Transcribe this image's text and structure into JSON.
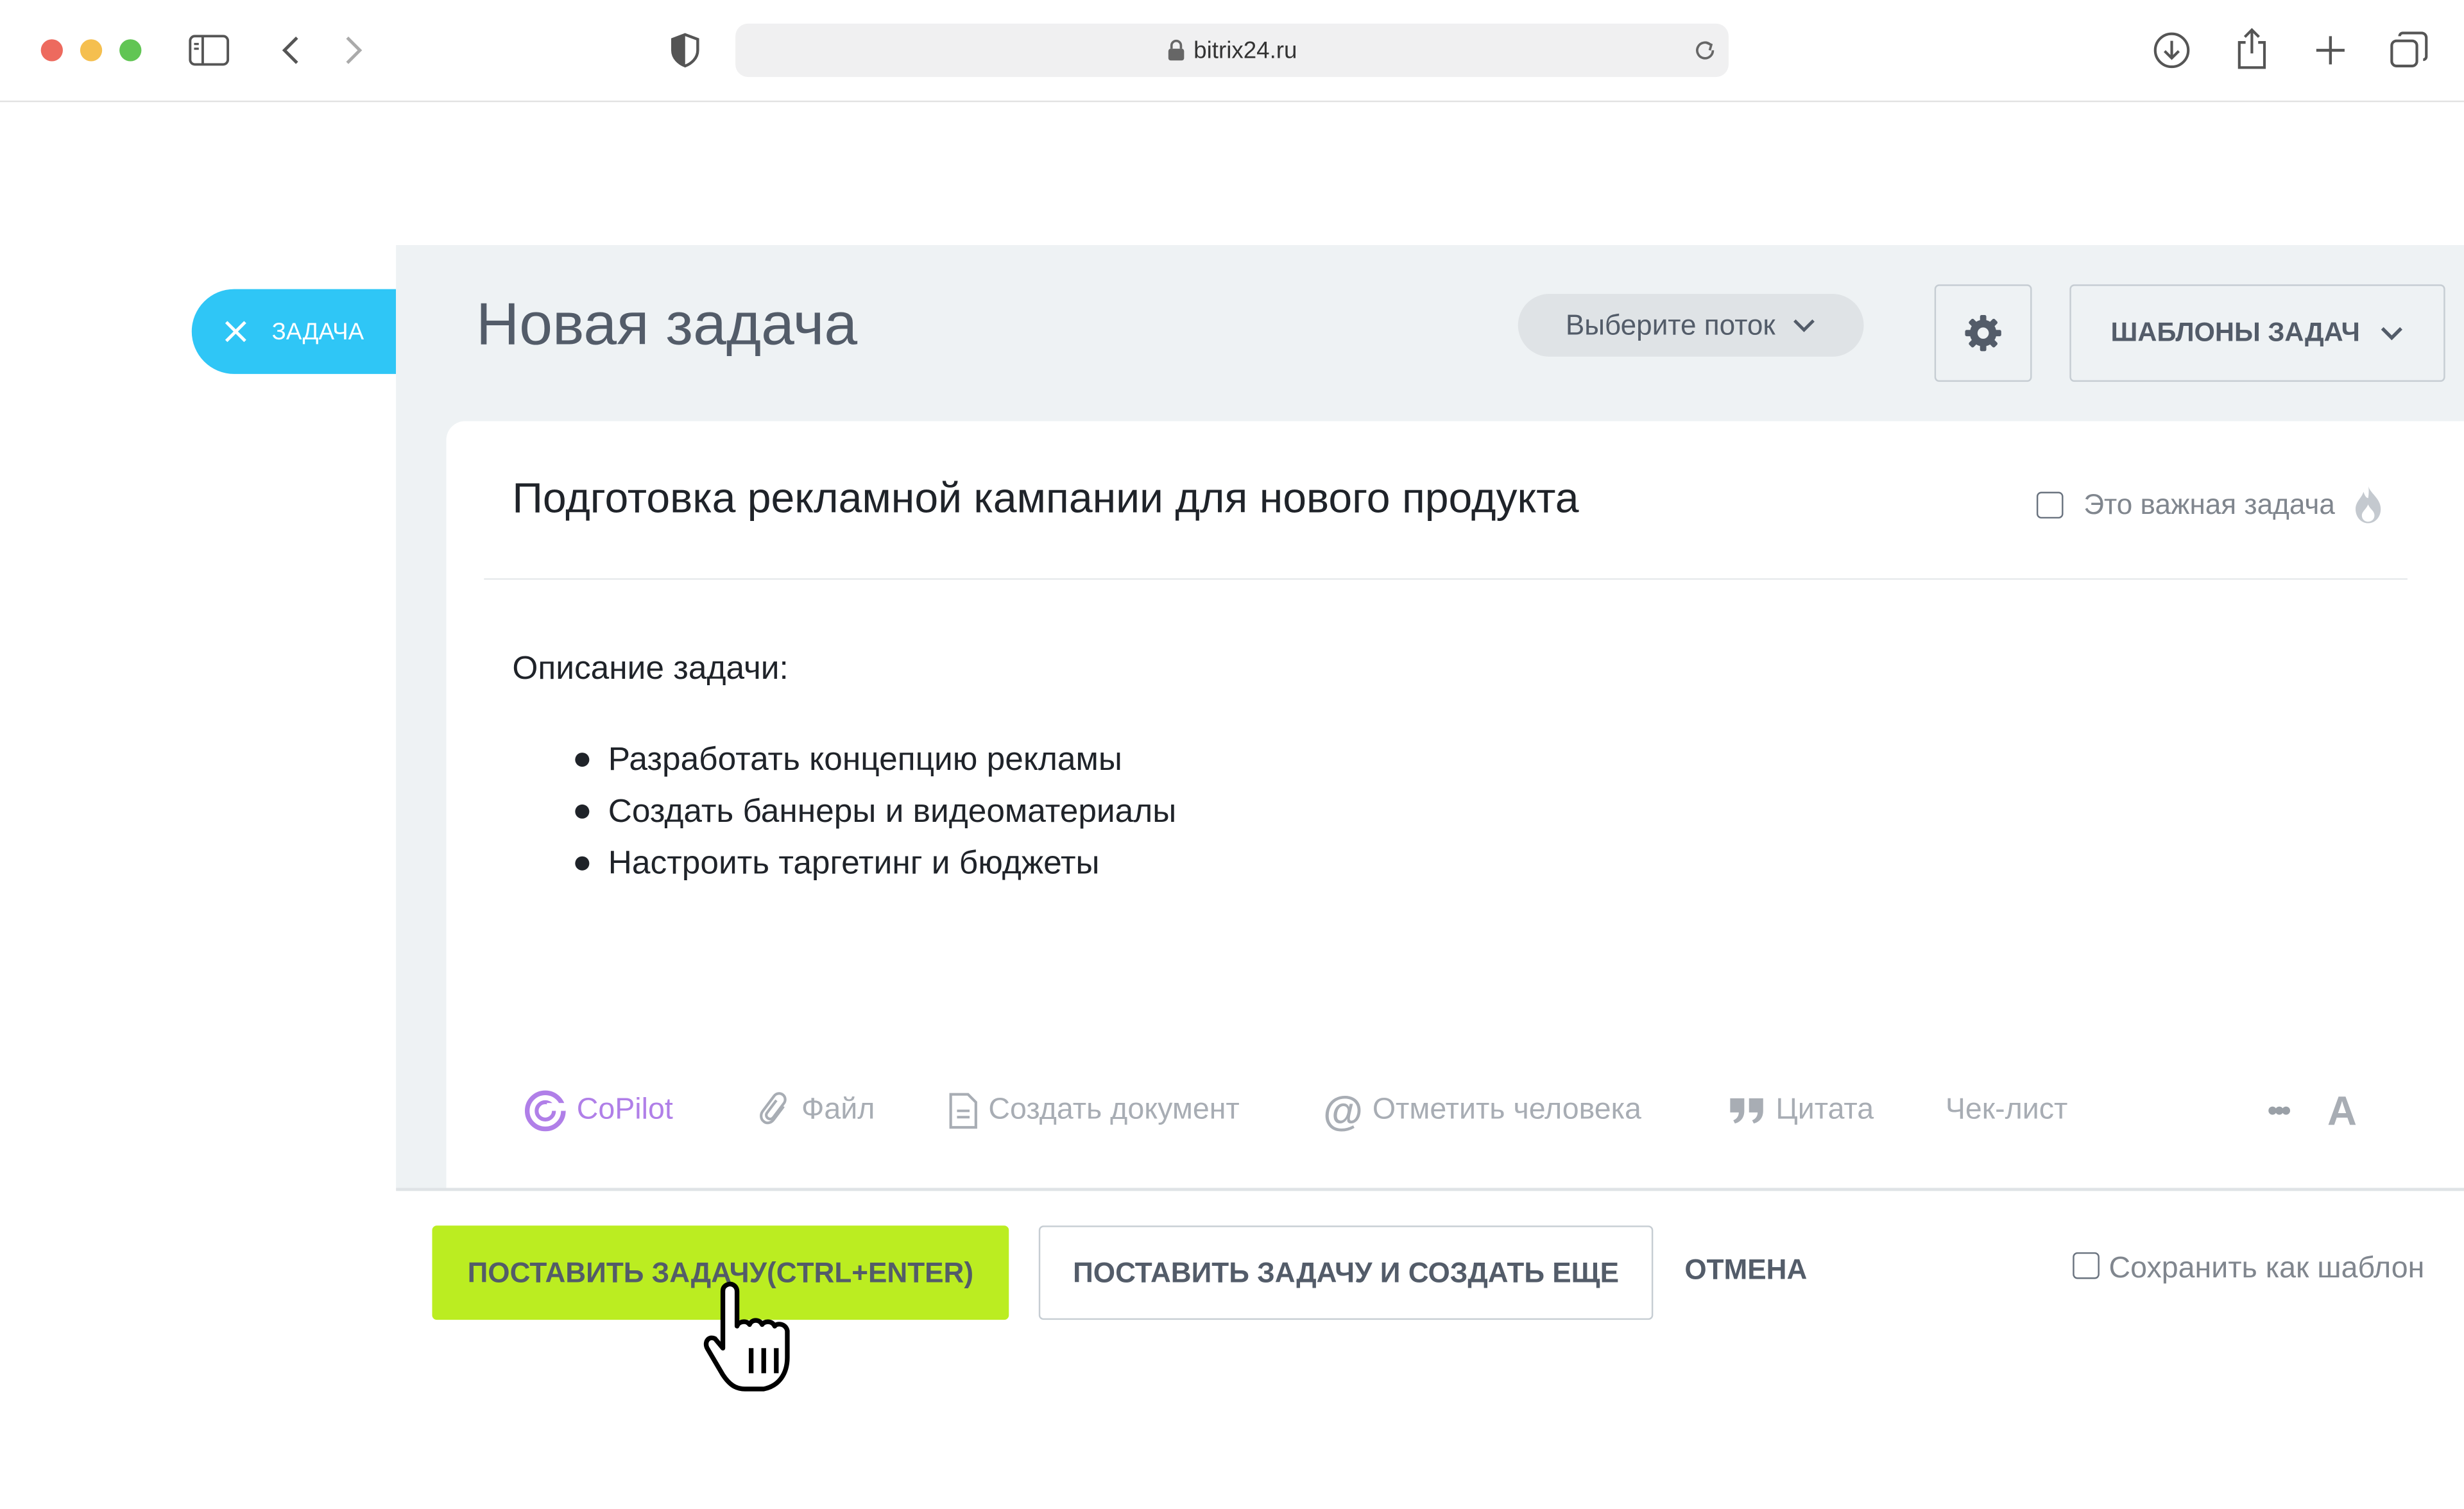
{
  "browser": {
    "url": "bitrix24.ru",
    "traffic_lights": [
      "#ed6a5e",
      "#f5bf4f",
      "#61c554"
    ]
  },
  "side_tab": {
    "label": "ЗАДАЧА"
  },
  "header": {
    "title": "Новая задача",
    "flow_select": "Выберите поток",
    "templates_button": "ШАБЛОНЫ ЗАДАЧ"
  },
  "task": {
    "title": "Подготовка рекламной кампании для нового продукта",
    "important_label": "Это важная задача",
    "description_heading": "Описание задачи:",
    "bullets": [
      "Разработать концепцию рекламы",
      "Создать баннеры и видеоматериалы",
      "Настроить таргетинг и бюджеты"
    ]
  },
  "editor_toolbar": {
    "copilot": "CoPilot",
    "file": "Файл",
    "create_doc": "Создать документ",
    "mention": "Отметить человека",
    "quote": "Цитата",
    "checklist": "Чек-лист",
    "more": "•••",
    "format": "A"
  },
  "actions": {
    "submit": "ПОСТАВИТЬ ЗАДАЧУ(CTRL+ENTER)",
    "submit_and_new": "ПОСТАВИТЬ ЗАДАЧУ И СОЗДАТЬ ЕЩЕ",
    "cancel": "ОТМЕНА",
    "save_as_template": "Сохранить как шаблон"
  },
  "colors": {
    "accent_green": "#bbed21",
    "tab_blue": "#2fc6f6",
    "copilot_purple": "#b07fe8"
  }
}
